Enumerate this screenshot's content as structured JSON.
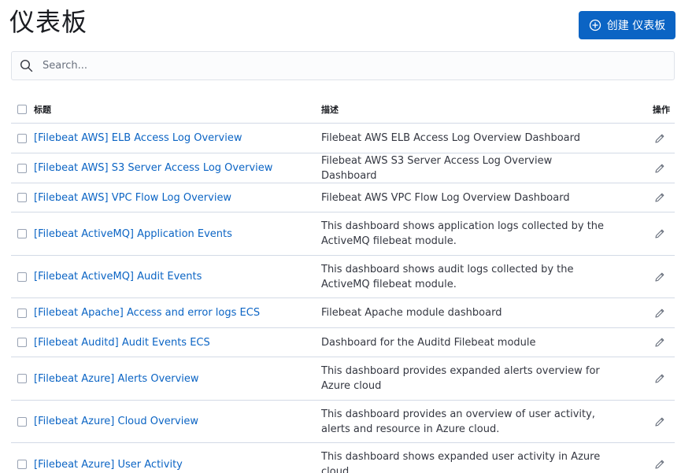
{
  "page": {
    "title": "仪表板"
  },
  "toolbar": {
    "create_label": "创建 仪表板"
  },
  "search": {
    "placeholder": "Search..."
  },
  "table": {
    "columns": {
      "title": "标题",
      "description": "描述",
      "actions": "操作"
    },
    "rows": [
      {
        "title": "[Filebeat AWS] ELB Access Log Overview",
        "description": "Filebeat AWS ELB Access Log Overview Dashboard"
      },
      {
        "title": "[Filebeat AWS] S3 Server Access Log Overview",
        "description": "Filebeat AWS S3 Server Access Log Overview Dashboard"
      },
      {
        "title": "[Filebeat AWS] VPC Flow Log Overview",
        "description": "Filebeat AWS VPC Flow Log Overview Dashboard"
      },
      {
        "title": "[Filebeat ActiveMQ] Application Events",
        "description": "This dashboard shows application logs collected by the ActiveMQ filebeat module."
      },
      {
        "title": "[Filebeat ActiveMQ] Audit Events",
        "description": "This dashboard shows audit logs collected by the ActiveMQ filebeat module."
      },
      {
        "title": "[Filebeat Apache] Access and error logs ECS",
        "description": "Filebeat Apache module dashboard"
      },
      {
        "title": "[Filebeat Auditd] Audit Events ECS",
        "description": "Dashboard for the Auditd Filebeat module"
      },
      {
        "title": "[Filebeat Azure] Alerts Overview",
        "description": "This dashboard provides expanded alerts overview for Azure cloud"
      },
      {
        "title": "[Filebeat Azure] Cloud Overview",
        "description": "This dashboard provides an overview of user activity, alerts and resource in Azure cloud."
      },
      {
        "title": "[Filebeat Azure] User Activity",
        "description": "This dashboard shows expanded user activity in Azure cloud"
      }
    ]
  },
  "colors": {
    "primary": "#0b64c4",
    "link": "#0b64c4",
    "border": "#d3dae6"
  }
}
